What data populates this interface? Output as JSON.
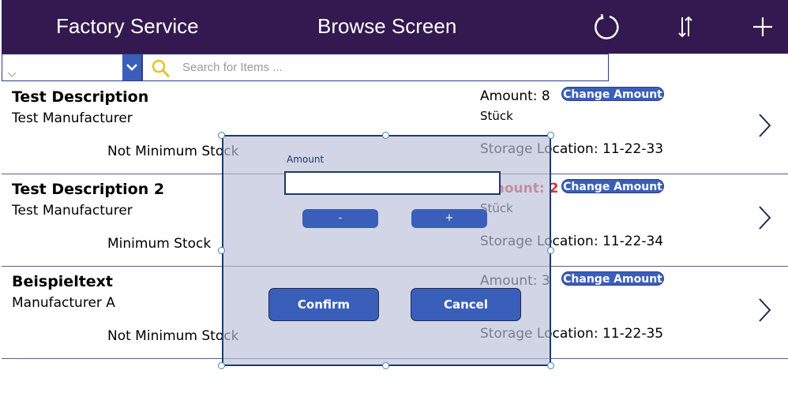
{
  "header": {
    "app_title": "Factory Service",
    "screen_title": "Browse Screen",
    "icons": [
      "refresh-icon",
      "sort-icon",
      "add-icon"
    ],
    "bg_color": "#33194f"
  },
  "filter": {
    "dropdown_value": "",
    "search_placeholder": "Search for Items ..."
  },
  "items": [
    {
      "title": "Test Description",
      "manufacturer": "Test Manufacturer",
      "stock_status": "Not Minimum Stock",
      "amount": "Amount: 8",
      "unit": "Stück",
      "location": "Storage Location: 11-22-33",
      "change_label": "Change Amount",
      "low": false
    },
    {
      "title": "Test Description 2",
      "manufacturer": "Test Manufacturer",
      "stock_status": "Minimum Stock",
      "amount": "Amount: 2",
      "unit": "Stück",
      "location": "Storage Location: 11-22-34",
      "change_label": "Change Amount",
      "low": true
    },
    {
      "title": "Beispieltext",
      "manufacturer": "Manufacturer A",
      "stock_status": "Not Minimum Stock",
      "amount": "Amount: 3",
      "unit": "",
      "location": "Storage Location: 11-22-35",
      "change_label": "Change Amount",
      "low": false
    }
  ],
  "dialog": {
    "amount_label": "Amount",
    "amount_value": "",
    "minus_label": "-",
    "plus_label": "+",
    "confirm_label": "Confirm",
    "cancel_label": "Cancel"
  },
  "colors": {
    "accent": "#3a5fba",
    "low_stock": "#d13438"
  }
}
